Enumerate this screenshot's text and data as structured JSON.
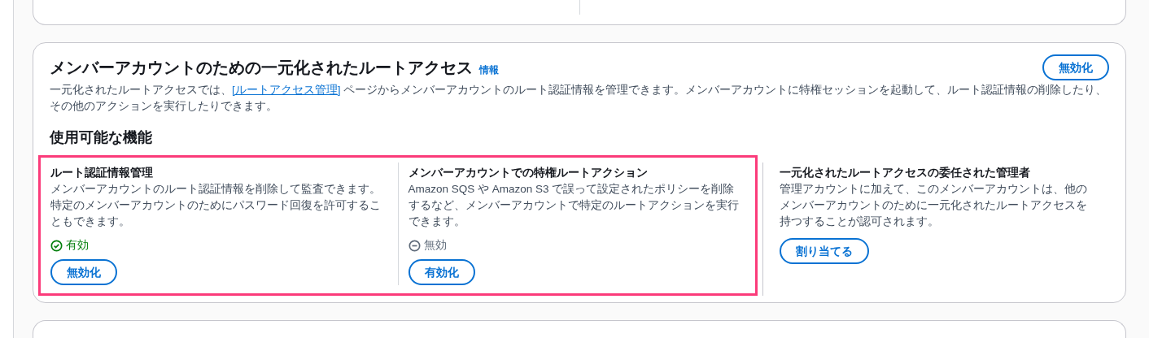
{
  "section": {
    "title": "メンバーアカウントのための一元化されたルートアクセス",
    "info_link": "情報",
    "action_button": "無効化",
    "description": {
      "before": "一元化されたルートアクセスでは、",
      "link": "[ルートアクセス管理]",
      "after": " ページからメンバーアカウントのルート認証情報を管理できます。メンバーアカウントに特権セッションを起動して、ルート認証情報の削除したり、その他のアクションを実行したりできます。"
    },
    "features_heading": "使用可能な機能",
    "features": [
      {
        "title": "ルート認証情報管理",
        "text": "メンバーアカウントのルート認証情報を削除して監査できます。特定のメンバーアカウントのためにパスワード回復を許可することもできます。",
        "highlighted": true,
        "status": {
          "kind": "enabled",
          "label": "有効"
        },
        "button": "無効化"
      },
      {
        "title": "メンバーアカウントでの特権ルートアクション",
        "text": "Amazon SQS や Amazon S3 で誤って設定されたポリシーを削除するなど、メンバーアカウントで特定のルートアクションを実行できます。",
        "highlighted": true,
        "status": {
          "kind": "disabled",
          "label": "無効"
        },
        "button": "有効化"
      },
      {
        "title": "一元化されたルートアクセスの委任された管理者",
        "text": "管理アカウントに加えて、このメンバーアカウントは、他のメンバーアカウントのために一元化されたルートアクセスを持つすることが認可されます。",
        "highlighted": false,
        "button": "割り当てる"
      }
    ]
  }
}
